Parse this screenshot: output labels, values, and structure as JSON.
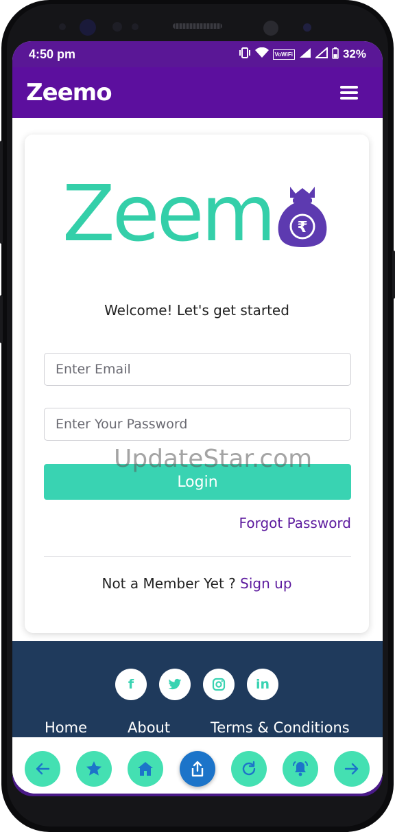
{
  "status_bar": {
    "time": "4:50 pm",
    "network_label": "VoWiFi",
    "battery": "32%"
  },
  "navbar": {
    "logo": "Zeemo",
    "menu_icon": "hamburger-icon"
  },
  "login_card": {
    "welcome": "Welcome! Let's get started",
    "email_placeholder": "Enter Email",
    "password_placeholder": "Enter Your Password",
    "login_button": "Login",
    "forgot_password": "Forgot Password",
    "not_member": "Not a Member Yet ?",
    "signup": "Sign up",
    "logo_word": "Zeem",
    "rupee_symbol": "₹"
  },
  "footer": {
    "social": [
      {
        "name": "facebook-icon",
        "glyph": "f"
      },
      {
        "name": "twitter-icon",
        "glyph": "t"
      },
      {
        "name": "instagram-icon",
        "glyph": "◎"
      },
      {
        "name": "linkedin-icon",
        "glyph": "in"
      }
    ],
    "links": [
      "Home",
      "About",
      "Terms & Conditions"
    ]
  },
  "bottom_bar": {
    "icons": [
      "back-arrow-icon",
      "star-icon",
      "home-icon",
      "share-icon",
      "refresh-icon",
      "bell-icon",
      "forward-arrow-icon"
    ],
    "active_index": 3
  },
  "watermark": "UpdateStar.com",
  "colors": {
    "brand_purple": "#5c0f9e",
    "accent_teal": "#39d3b2",
    "footer_navy": "#1f3a5c",
    "link_purple": "#5c1a9e",
    "active_blue": "#1c74c9"
  }
}
